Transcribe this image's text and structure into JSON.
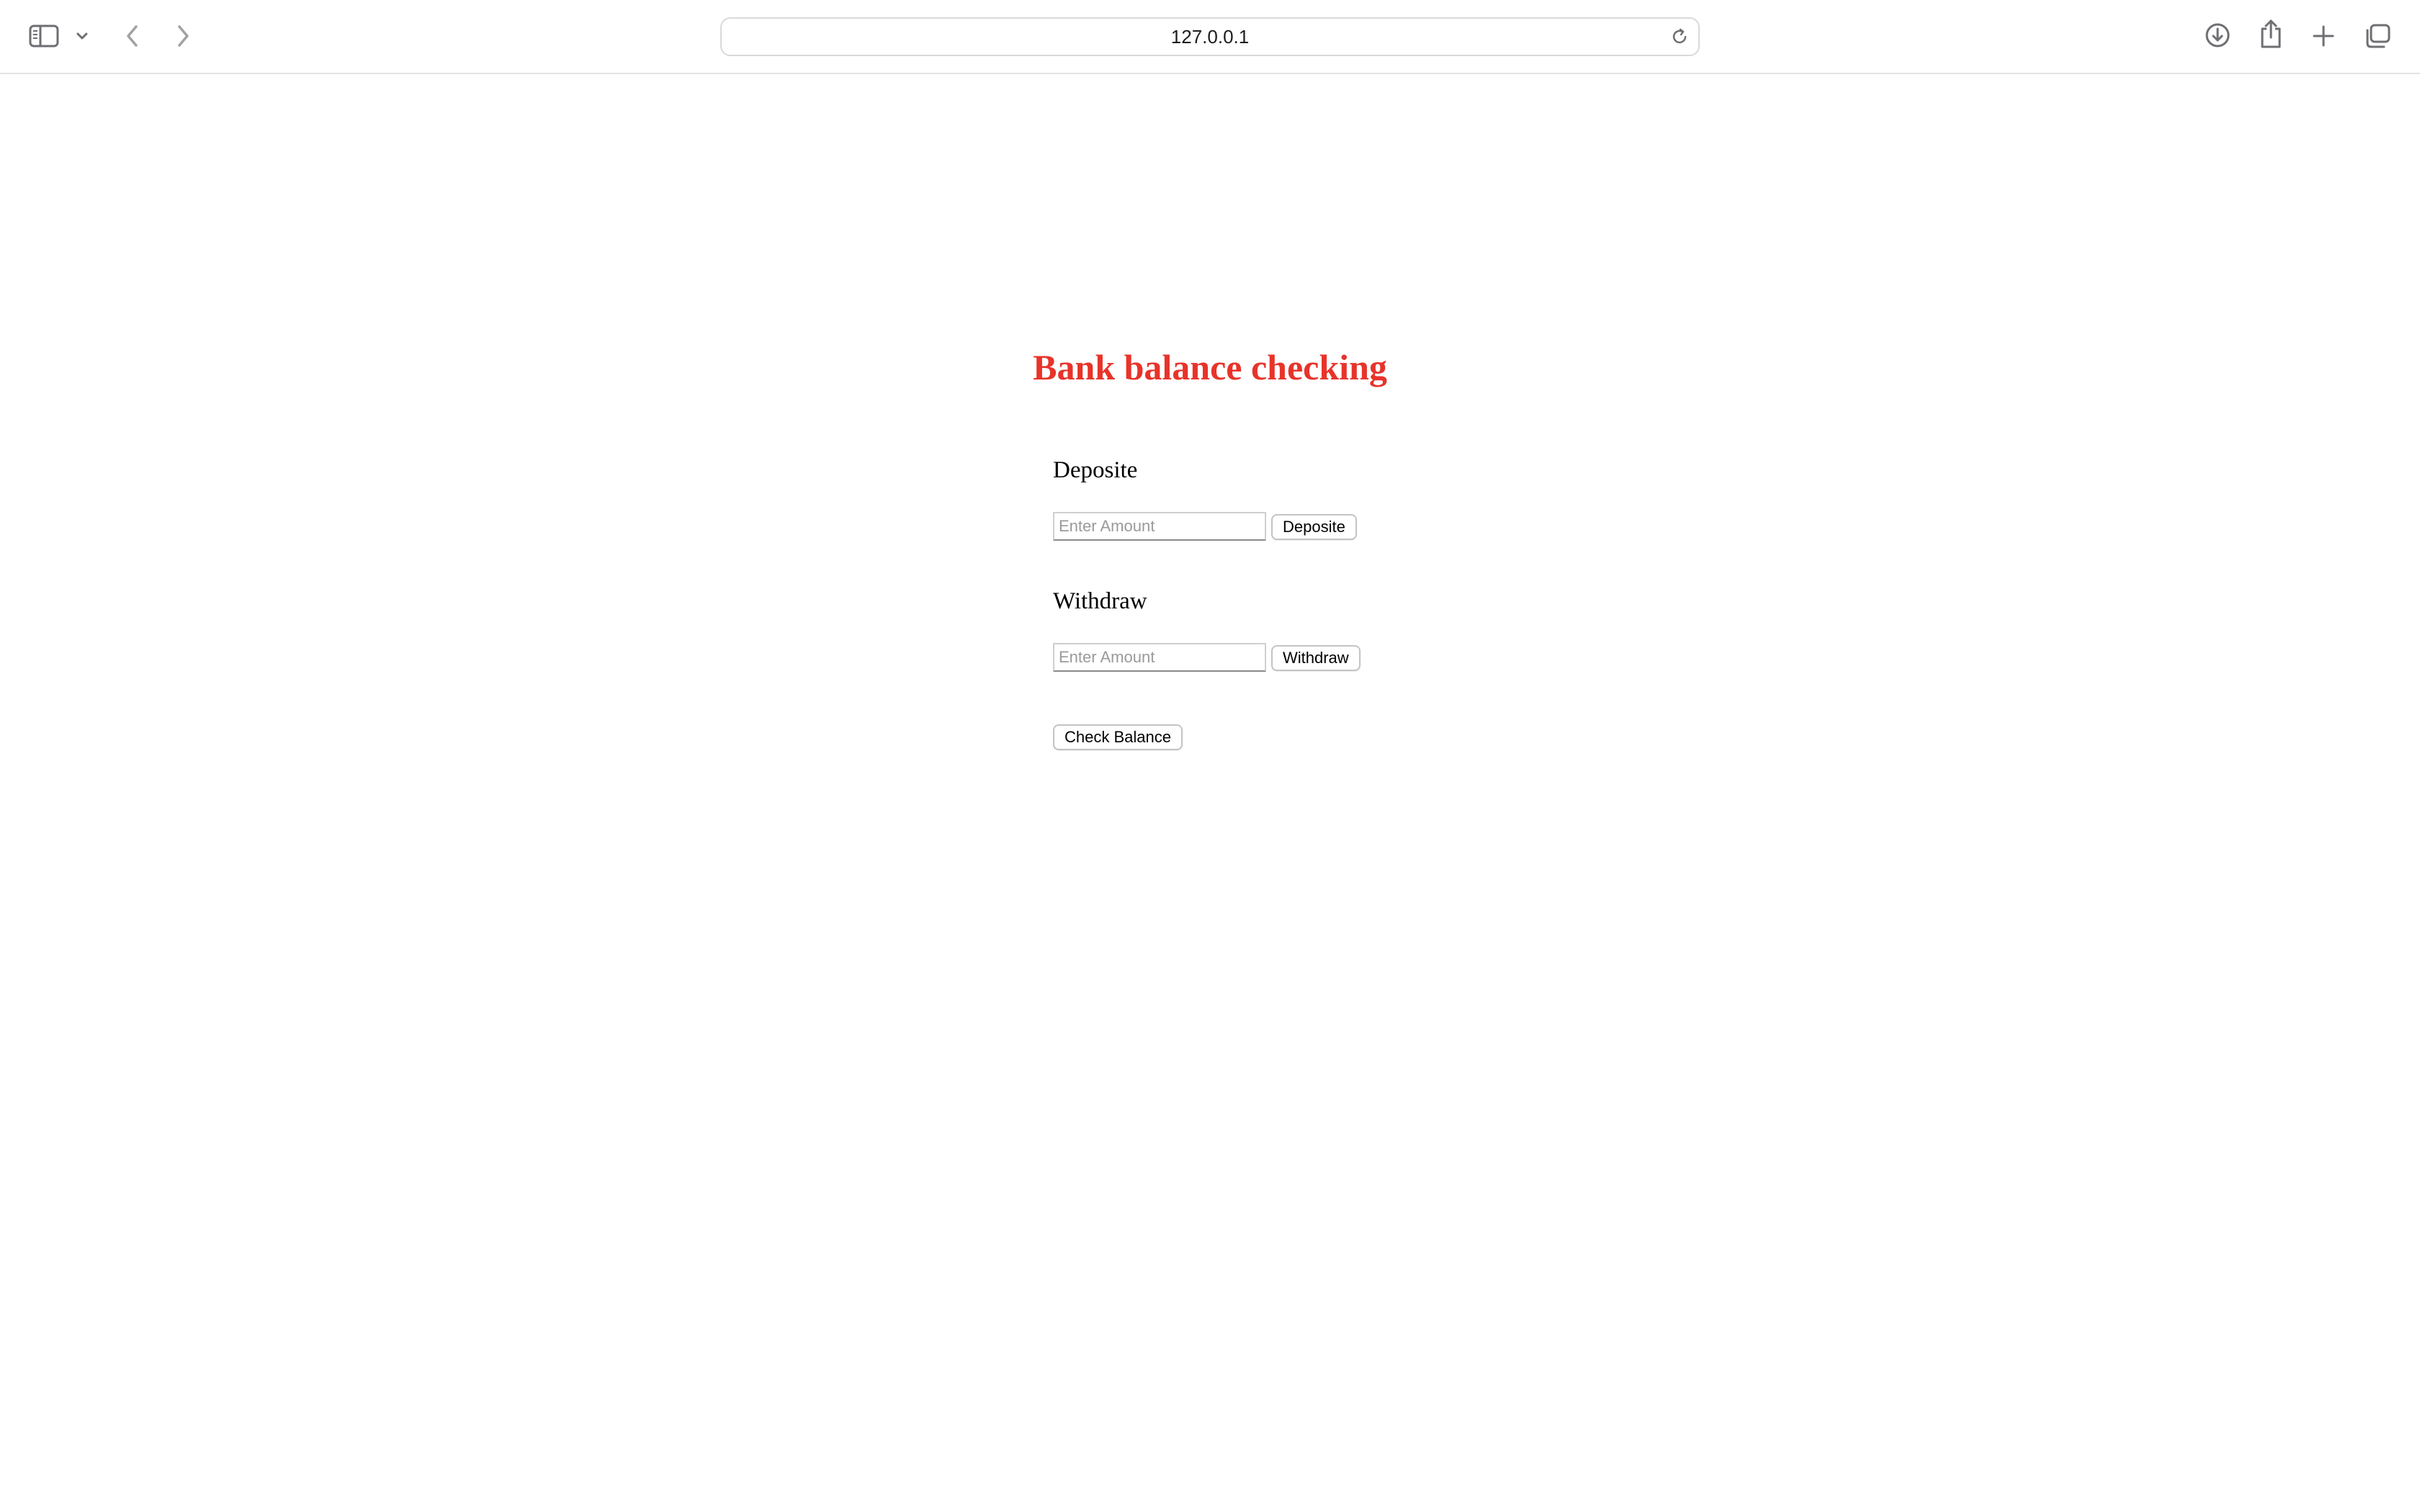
{
  "browser": {
    "url": "127.0.0.1"
  },
  "toolbar": {
    "icons": {
      "sidebar": "sidebar-icon",
      "sidebar_menu": "chevron-down-icon",
      "back": "chevron-left-icon",
      "forward": "chevron-right-icon",
      "reload": "reload-icon",
      "download": "download-icon",
      "share": "share-icon",
      "new_tab": "plus-icon",
      "tab_overview": "tabs-icon"
    }
  },
  "page": {
    "title": "Bank balance checking",
    "title_color": "#e8332a",
    "deposit": {
      "label": "Deposite",
      "input_placeholder": "Enter Amount",
      "input_value": "",
      "button_label": "Deposite"
    },
    "withdraw": {
      "label": "Withdraw",
      "input_placeholder": "Enter Amount",
      "input_value": "",
      "button_label": "Withdraw"
    },
    "check_balance": {
      "button_label": "Check Balance"
    }
  }
}
